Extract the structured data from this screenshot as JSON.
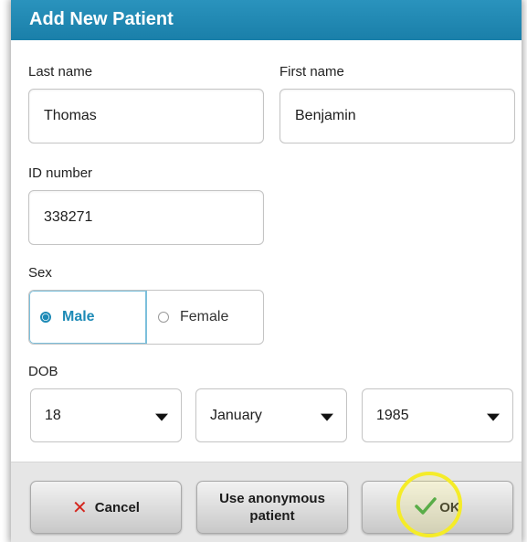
{
  "dialog": {
    "title": "Add New Patient"
  },
  "form": {
    "last_name": {
      "label": "Last name",
      "value": "Thomas"
    },
    "first_name": {
      "label": "First name",
      "value": "Benjamin"
    },
    "id_number": {
      "label": "ID number",
      "value": "338271"
    },
    "sex": {
      "label": "Sex",
      "options": [
        "Male",
        "Female"
      ],
      "selected": "Male"
    },
    "dob": {
      "label": "DOB",
      "day": "18",
      "month": "January",
      "year": "1985"
    }
  },
  "buttons": {
    "cancel": "Cancel",
    "anonymous": "Use anonymous patient",
    "ok": "OK"
  },
  "colors": {
    "title_bar": "#1f88b3",
    "selected_accent": "#1d8ab6",
    "cancel_icon": "#d4261e",
    "ok_icon": "#2c9a3c",
    "highlight_ring": "#f5ec28"
  },
  "icons": {
    "cancel": "close-x-icon",
    "ok": "checkmark-icon",
    "select": "chevron-down-icon"
  }
}
